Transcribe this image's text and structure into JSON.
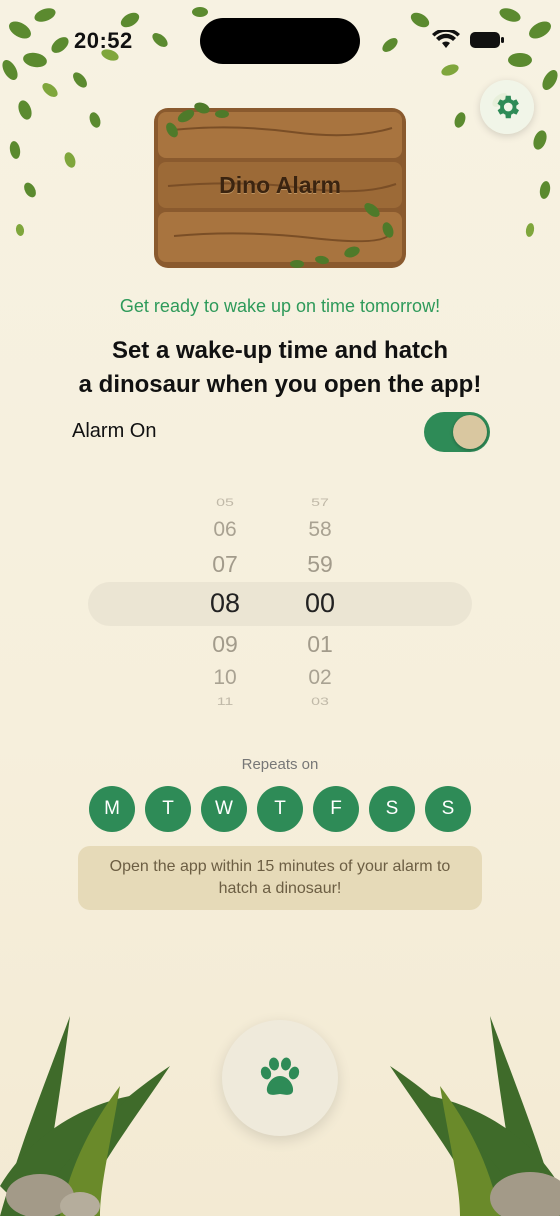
{
  "status_bar": {
    "time": "20:52"
  },
  "header": {
    "title": "Dino Alarm",
    "settings_icon": "gear-icon"
  },
  "subtitle": "Get ready to wake up on time tomorrow!",
  "heading_line1": "Set a wake-up time and hatch",
  "heading_line2": "a dinosaur when you open the app!",
  "alarm": {
    "label": "Alarm On",
    "enabled": true
  },
  "picker": {
    "hours": [
      "05",
      "06",
      "07",
      "08",
      "09",
      "10",
      "11"
    ],
    "minutes": [
      "57",
      "58",
      "59",
      "00",
      "01",
      "02",
      "03"
    ],
    "selected_hour": "08",
    "selected_minute": "00"
  },
  "repeats": {
    "label": "Repeats on",
    "days": [
      "M",
      "T",
      "W",
      "T",
      "F",
      "S",
      "S"
    ]
  },
  "info": "Open the app within 15 minutes of your alarm to hatch a dinosaur!",
  "bottom_button": {
    "icon": "paw-icon"
  },
  "colors": {
    "accent": "#2e8b57",
    "subtitle": "#2e9a5a",
    "background": "#f7f2e2",
    "info_bg": "#e6dab8"
  }
}
